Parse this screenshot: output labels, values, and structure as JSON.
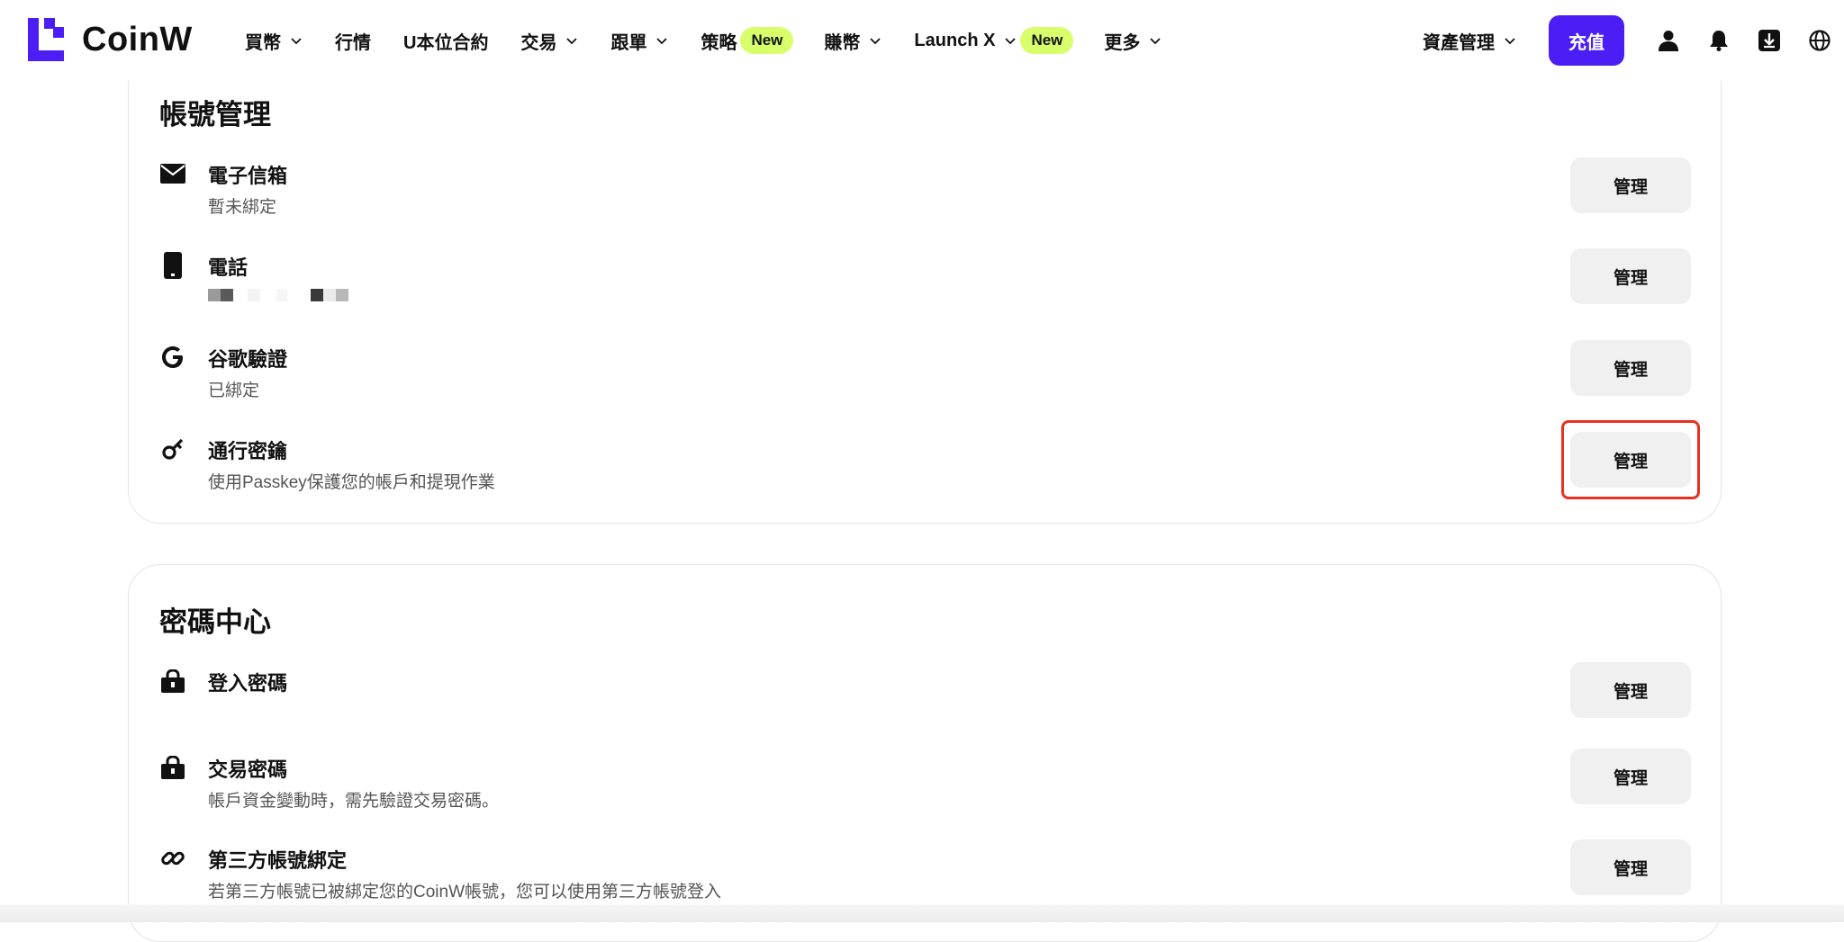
{
  "brand": {
    "name": "CoinW",
    "accent": "#4b1ef6",
    "badge_color": "#d8ff6b",
    "highlight_color": "#e8321f"
  },
  "nav": {
    "items": [
      {
        "label": "買幣",
        "dropdown": true
      },
      {
        "label": "行情",
        "dropdown": false
      },
      {
        "label": "U本位合約",
        "dropdown": false
      },
      {
        "label": "交易",
        "dropdown": true
      },
      {
        "label": "跟單",
        "dropdown": true
      },
      {
        "label": "策略",
        "badge": "New"
      },
      {
        "label": "賺幣",
        "dropdown": true
      },
      {
        "label": "Launch X",
        "dropdown": true,
        "badge": "New"
      },
      {
        "label": "更多",
        "dropdown": true
      }
    ],
    "asset_management": "資產管理",
    "deposit": "充值",
    "icons": [
      "user-icon",
      "bell-icon",
      "download-icon",
      "globe-icon"
    ]
  },
  "account_section": {
    "title": "帳號管理",
    "rows": [
      {
        "icon": "mail-icon",
        "title": "電子信箱",
        "subtitle": "暫未綁定",
        "button": "管理"
      },
      {
        "icon": "phone-icon",
        "title": "電話",
        "subtitle": "",
        "masked": true,
        "button": "管理"
      },
      {
        "icon": "google-icon",
        "title": "谷歌驗證",
        "subtitle": "已綁定",
        "button": "管理"
      },
      {
        "icon": "key-icon",
        "title": "通行密鑰",
        "subtitle": "使用Passkey保護您的帳戶和提現作業",
        "button": "管理",
        "highlighted": true
      }
    ]
  },
  "password_section": {
    "title": "密碼中心",
    "rows": [
      {
        "icon": "lock-icon",
        "title": "登入密碼",
        "subtitle": "",
        "button": "管理"
      },
      {
        "icon": "lock-icon",
        "title": "交易密碼",
        "subtitle": "帳戶資金變動時，需先驗證交易密碼。",
        "button": "管理"
      },
      {
        "icon": "link-icon",
        "title": "第三方帳號綁定",
        "subtitle": "若第三方帳號已被綁定您的CoinW帳號，您可以使用第三方帳號登入",
        "button": "管理"
      }
    ]
  }
}
